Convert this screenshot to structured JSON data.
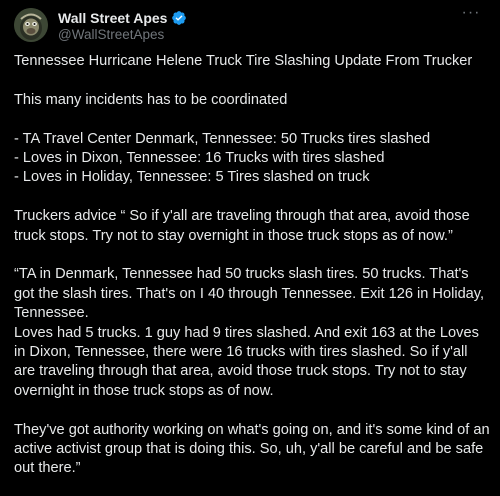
{
  "author": {
    "display_name": "Wall Street Apes",
    "handle": "@WallStreetApes",
    "verified": true,
    "accent_color": "#1d9bf0"
  },
  "menu": {
    "more_label": "···"
  },
  "tweet": {
    "line1": "Tennessee Hurricane Helene Truck Tire Slashing Update From Trucker",
    "line2": "This many incidents has to be coordinated",
    "list": [
      "- TA Travel Center Denmark, Tennessee: 50 Trucks tires slashed",
      "- Loves in Dixon, Tennessee: 16 Trucks with tires slashed",
      "- Loves in Holiday, Tennessee: 5 Tires slashed on truck"
    ],
    "advice": "Truckers advice “ So if y'all are traveling through that area, avoid those truck stops. Try not to stay overnight in those truck stops as of now.”",
    "quote_part1": "“TA in Denmark, Tennessee had 50 trucks slash tires. 50 trucks. That's got the slash tires. That's on I 40 through Tennessee. Exit 126 in Holiday, Tennessee.",
    "quote_part2": "Loves had 5 trucks. 1 guy had 9 tires slashed. And exit 163 at the Loves in Dixon, Tennessee, there were 16 trucks with tires slashed. So if y'all are traveling through that area, avoid those truck stops. Try not to stay overnight in those truck stops as of now.",
    "closing": "They've got authority working on what's going on, and it's some kind of an active activist group that is doing this. So, uh, y'all be careful and be safe out there.”"
  }
}
